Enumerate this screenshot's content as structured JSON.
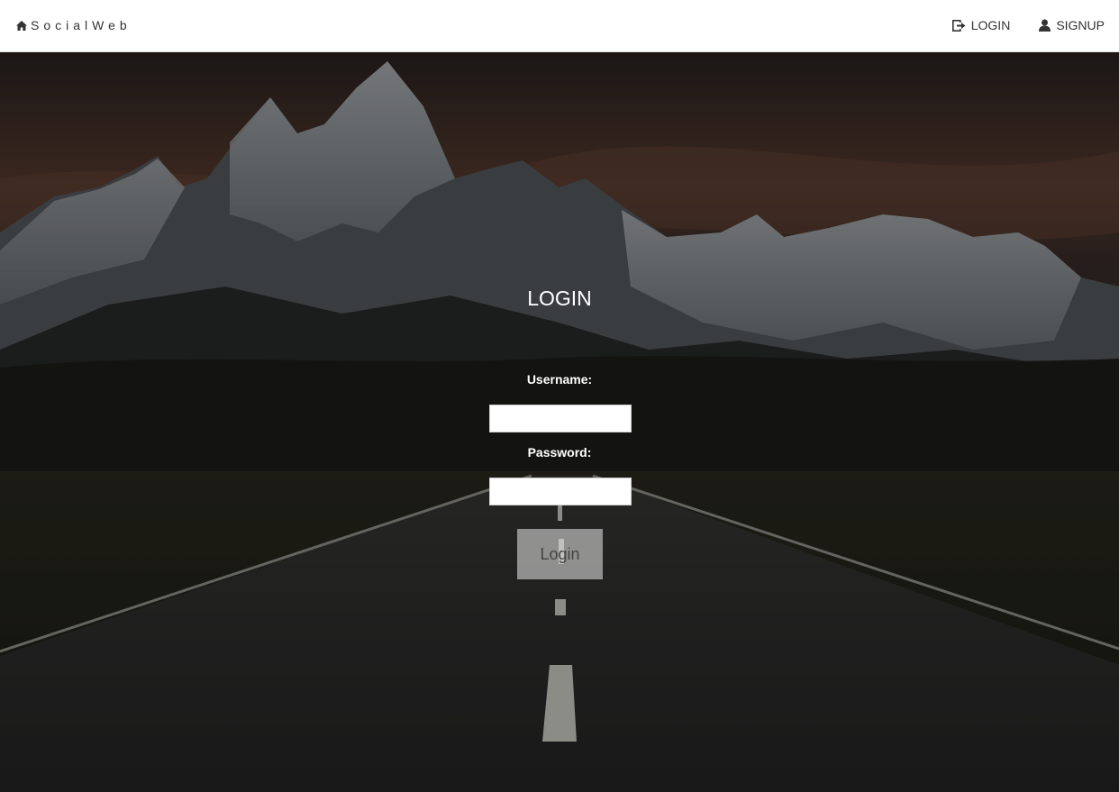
{
  "navbar": {
    "brand": "SocialWeb",
    "brand_icon": "home-icon",
    "links": [
      {
        "label": "LOGIN",
        "icon": "login-icon"
      },
      {
        "label": "SIGNUP",
        "icon": "user-icon"
      }
    ]
  },
  "login": {
    "title": "LOGIN",
    "username_label": "Username:",
    "username_value": "",
    "password_label": "Password:",
    "password_value": "",
    "submit_label": "Login"
  },
  "background": {
    "description_icon": "mountain-road-background",
    "overlay_color": "#000000"
  }
}
